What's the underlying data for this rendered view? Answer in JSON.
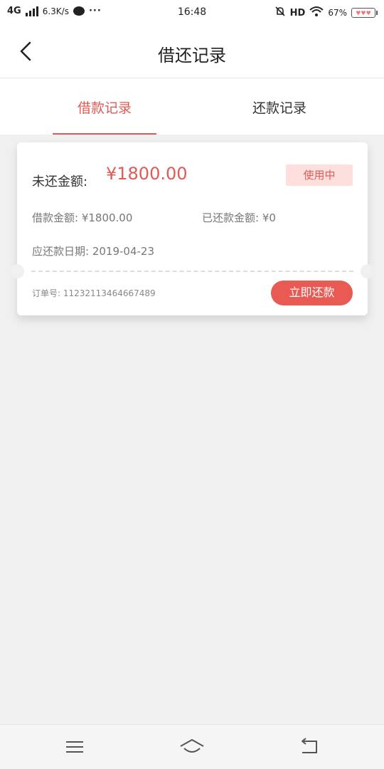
{
  "status_bar": {
    "network": "4G",
    "speed": "6.3K/s",
    "more": "···",
    "time": "16:48",
    "hd": "HD",
    "battery": "67%"
  },
  "header": {
    "title": "借还记录"
  },
  "tabs": [
    {
      "label": "借款记录",
      "active": true
    },
    {
      "label": "还款记录",
      "active": false
    }
  ],
  "record": {
    "unpaid_label": "未还金额:",
    "unpaid_value": "¥1800.00",
    "status": "使用中",
    "loan_amount": "借款金额: ¥1800.00",
    "repaid_amount": "已还款金额: ¥0",
    "due_date": "应还款日期: 2019-04-23",
    "order_no": "订单号: 11232113464667489",
    "repay_button": "立即还款"
  },
  "colors": {
    "accent": "#e05a55",
    "badge_bg": "#fde0de",
    "page_bg": "#f0f0f0"
  },
  "nav_icons": [
    "menu-icon",
    "home-icon",
    "back-icon"
  ]
}
